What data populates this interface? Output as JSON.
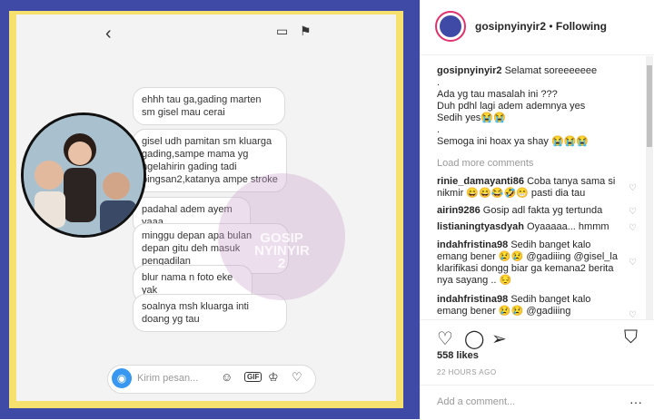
{
  "header": {
    "username": "gosipnyinyir2",
    "separator": "•",
    "follow_status": "Following"
  },
  "chat": {
    "bubbles": [
      "ehhh tau ga,gading marten sm gisel mau cerai",
      "gisel udh pamitan sm kluarga gading,sampe mama yg ngelahirin gading tadi pingsan2,katanya ampe stroke",
      "padahal adem ayem yaaa",
      "minggu depan apa bulan depan gitu deh masuk pengadilan",
      "blur nama n foto eke yak",
      "soalnya msh kluarga inti doang yg tau"
    ],
    "compose_placeholder": "Kirim pesan...",
    "watermark": "GOSIP NYINYIR 2"
  },
  "caption": {
    "username": "gosipnyinyir2",
    "lines": [
      "Selamat soreeeeeee",
      ".",
      "Ada yg tau masalah ini ???",
      "Duh pdhl lagi adem ademnya yes",
      "Sedih yes😭😭",
      ".",
      "Semoga ini hoax ya shay 😭😭😭"
    ]
  },
  "load_more": "Load more comments",
  "comments": [
    {
      "user": "rinie_damayanti86",
      "text": "Coba tanya sama si nikmir 😄😄😂🤣😁 pasti dia tau"
    },
    {
      "user": "airin9286",
      "text": "Gosip adl fakta yg tertunda"
    },
    {
      "user": "listianingtyasdyah",
      "text": "Oyaaaaa... hmmm"
    },
    {
      "user": "indahfristina98",
      "text": "Sedih banget kalo emang bener 😢😢 @gadiiing @gisel_la klarifikasi dongg biar ga kemana2 berita nya sayang .. 😔"
    },
    {
      "user": "indahfristina98",
      "text": "Sedih banget kalo emang bener 😢😢 @gadiiing"
    }
  ],
  "likes": "558 likes",
  "timestamp": "22 HOURS AGO",
  "add_comment_placeholder": "Add a comment...",
  "icons": {
    "like": "heart-icon",
    "comment": "comment-icon",
    "share": "share-icon",
    "save": "bookmark-icon",
    "more": "more-icon"
  },
  "colors": {
    "frame_blue": "#3f4aa6",
    "frame_yellow": "#f6e06e",
    "link_blue": "#003569"
  }
}
